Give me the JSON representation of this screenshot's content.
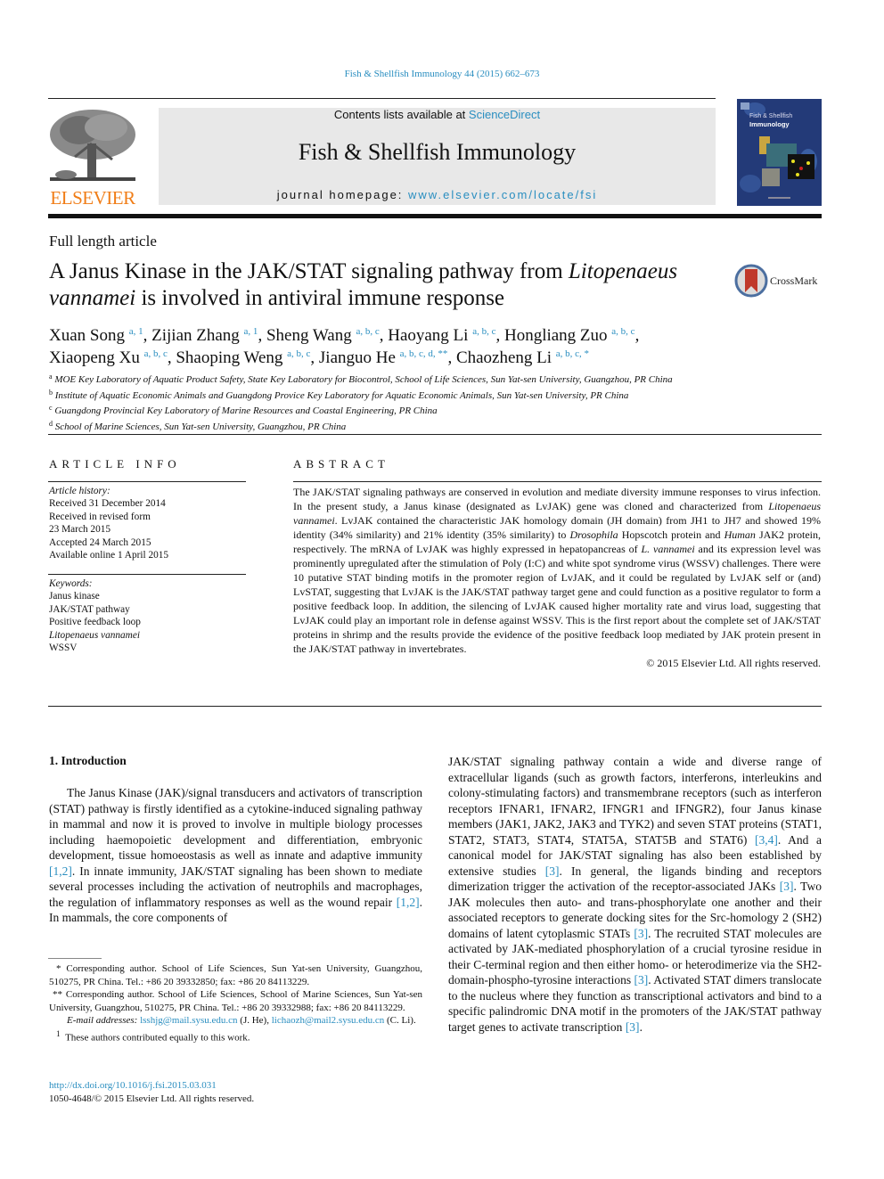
{
  "header": {
    "citation": "Fish & Shellfish Immunology 44 (2015) 662–673",
    "contents_prefix": "Contents lists available at ",
    "contents_link": "ScienceDirect",
    "journal_title": "Fish & Shellfish Immunology",
    "homepage_prefix": "journal homepage: ",
    "homepage_link": "www.elsevier.com/locate/fsi",
    "publisher_logo": "ELSEVIER",
    "cover_title_line1": "Fish & Shellfish",
    "cover_title_line2": "Immunology",
    "colors": {
      "link": "#2a8ec0",
      "publisher": "#f07d17",
      "banner_bg": "#e8e8e8",
      "cover_bg": "#233a78"
    }
  },
  "article": {
    "type": "Full length article",
    "title_part1": "A Janus Kinase in the JAK/STAT signaling pathway from ",
    "title_italic1": "Litopenaeus vannamei",
    "title_part2": " is involved in antiviral immune response",
    "crossmark_label": "CrossMark",
    "authors": [
      {
        "name": "Xuan Song",
        "sup": "a, 1",
        "sep": ", "
      },
      {
        "name": "Zijian Zhang",
        "sup": "a, 1",
        "sep": ", "
      },
      {
        "name": "Sheng Wang",
        "sup": "a, b, c",
        "sep": ", "
      },
      {
        "name": "Haoyang Li",
        "sup": "a, b, c",
        "sep": ", "
      },
      {
        "name": "Hongliang Zuo",
        "sup": "a, b, c",
        "sep": ","
      },
      {
        "name": "Xiaopeng Xu",
        "sup": "a, b, c",
        "sep": ", "
      },
      {
        "name": "Shaoping Weng",
        "sup": "a, b, c",
        "sep": ", "
      },
      {
        "name": "Jianguo He",
        "sup": "a, b, c, d, **",
        "sep": ", "
      },
      {
        "name": "Chaozheng Li",
        "sup": "a, b, c, *",
        "sep": ""
      }
    ],
    "affiliations": [
      {
        "key": "a",
        "text": "MOE Key Laboratory of Aquatic Product Safety, State Key Laboratory for Biocontrol, School of Life Sciences, Sun Yat-sen University, Guangzhou, PR China"
      },
      {
        "key": "b",
        "text": "Institute of Aquatic Economic Animals and Guangdong Provice Key Laboratory for Aquatic Economic Animals, Sun Yat-sen University, PR China"
      },
      {
        "key": "c",
        "text": "Guangdong Provincial Key Laboratory of Marine Resources and Coastal Engineering, PR China"
      },
      {
        "key": "d",
        "text": "School of Marine Sciences, Sun Yat-sen University, Guangzhou, PR China"
      }
    ]
  },
  "article_info": {
    "heading": "ARTICLE INFO",
    "history_label": "Article history:",
    "history": [
      "Received 31 December 2014",
      "Received in revised form",
      "23 March 2015",
      "Accepted 24 March 2015",
      "Available online 1 April 2015"
    ],
    "keywords_label": "Keywords:",
    "keywords": [
      "Janus kinase",
      "JAK/STAT pathway",
      "Positive feedback loop",
      "Litopenaeus vannamei",
      "WSSV"
    ]
  },
  "abstract": {
    "heading": "ABSTRACT",
    "text": "The JAK/STAT signaling pathways are conserved in evolution and mediate diversity immune responses to virus infection. In the present study, a Janus kinase (designated as LvJAK) gene was cloned and characterized from Litopenaeus vannamei. LvJAK contained the characteristic JAK homology domain (JH domain) from JH1 to JH7 and showed 19% identity (34% similarity) and 21% identity (35% similarity) to Drosophila Hopscotch protein and Human JAK2 protein, respectively. The mRNA of LvJAK was highly expressed in hepatopancreas of L. vannamei and its expression level was prominently upregulated after the stimulation of Poly (I:C) and white spot syndrome virus (WSSV) challenges. There were 10 putative STAT binding motifs in the promoter region of LvJAK, and it could be regulated by LvJAK self or (and) LvSTAT, suggesting that LvJAK is the JAK/STAT pathway target gene and could function as a positive regulator to form a positive feedback loop. In addition, the silencing of LvJAK caused higher mortality rate and virus load, suggesting that LvJAK could play an important role in defense against WSSV. This is the first report about the complete set of JAK/STAT proteins in shrimp and the results provide the evidence of the positive feedback loop mediated by JAK protein present in the JAK/STAT pathway in invertebrates.",
    "rights": "© 2015 Elsevier Ltd. All rights reserved."
  },
  "introduction": {
    "heading": "1.  Introduction",
    "col1": [
      {
        "t": "The Janus Kinase (JAK)/signal transducers and activators of transcription (STAT) pathway is firstly identified as a cytokine-induced signaling pathway in mammal and now it is proved to involve in multiple biology processes including haemopoietic development and differentiation, embryonic development, tissue homoeostasis as well as innate and adaptive immunity "
      },
      {
        "ref": "[1,2]"
      },
      {
        "t": ". In innate immunity, JAK/STAT signaling has been shown to mediate several processes including the activation of neutrophils and macrophages, the regulation of inflammatory responses as well as the wound repair "
      },
      {
        "ref": "[1,2]"
      },
      {
        "t": ". In mammals, the core components of"
      }
    ],
    "col2": [
      {
        "t": "JAK/STAT signaling pathway contain a wide and diverse range of extracellular ligands (such as growth factors, interferons, interleukins and colony-stimulating factors) and transmembrane receptors (such as interferon receptors IFNAR1, IFNAR2, IFNGR1 and IFNGR2), four Janus kinase members (JAK1, JAK2, JAK3 and TYK2) and seven STAT proteins (STAT1, STAT2, STAT3, STAT4, STAT5A, STAT5B and STAT6) "
      },
      {
        "ref": "[3,4]"
      },
      {
        "t": ". And a canonical model for JAK/STAT signaling has also been established by extensive studies "
      },
      {
        "ref": "[3]"
      },
      {
        "t": ". In general, the ligands binding and receptors dimerization trigger the activation of the receptor-associated JAKs "
      },
      {
        "ref": "[3]"
      },
      {
        "t": ". Two JAK molecules then auto- and trans-phosphorylate one another and their associated receptors to generate docking sites for the Src-homology 2 (SH2) domains of latent cytoplasmic STATs "
      },
      {
        "ref": "[3]"
      },
      {
        "t": ". The recruited STAT molecules are activated by JAK-mediated phosphorylation of a crucial tyrosine residue in their C-terminal region and then either homo- or heterodimerize via the SH2-domain-phospho-tyrosine interactions "
      },
      {
        "ref": "[3]"
      },
      {
        "t": ". Activated STAT dimers translocate to the nucleus where they function as transcriptional activators and bind to a specific palindromic DNA motif in the promoters of the JAK/STAT pathway target genes to activate transcription "
      },
      {
        "ref": "[3]"
      },
      {
        "t": "."
      }
    ]
  },
  "footnotes": {
    "corr1": "* Corresponding author. School of Life Sciences, Sun Yat-sen University, Guangzhou, 510275, PR China. Tel.: +86 20 39332850; fax: +86 20 84113229.",
    "corr2": "** Corresponding author. School of Life Sciences, School of Marine Sciences, Sun Yat-sen University, Guangzhou, 510275, PR China. Tel.: +86 20 39332988; fax: +86 20 84113229.",
    "email_label": "E-mail addresses:",
    "email1": "lsshjg@mail.sysu.edu.cn",
    "email1_owner": " (J. He), ",
    "email2": "lichaozh@mail2.sysu.edu.cn",
    "email2_owner": " (C. Li).",
    "equal_mark": "1",
    "equal": "These authors contributed equally to this work.",
    "doi": "http://dx.doi.org/10.1016/j.fsi.2015.03.031",
    "issn": "1050-4648/© 2015 Elsevier Ltd. All rights reserved."
  }
}
